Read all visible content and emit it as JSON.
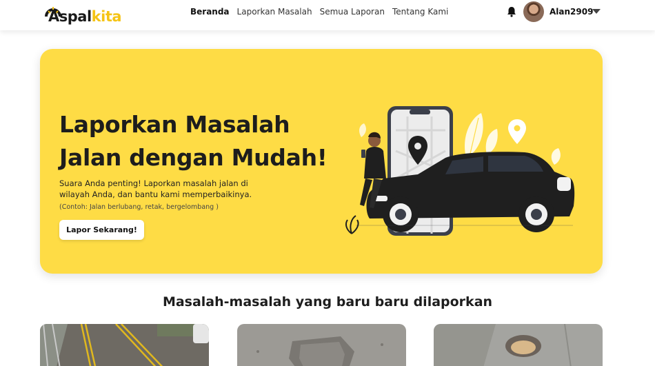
{
  "brand": {
    "part1": "Aspal",
    "part2": "kita",
    "accent": "#f5c416"
  },
  "nav": {
    "items": [
      {
        "label": "Beranda",
        "active": true
      },
      {
        "label": "Laporkan Masalah",
        "active": false
      },
      {
        "label": "Semua Laporan",
        "active": false
      },
      {
        "label": "Tentang Kami",
        "active": false
      }
    ]
  },
  "user": {
    "name": "Alan2909",
    "icons": [
      "bell-icon",
      "chevron-down-icon"
    ]
  },
  "hero": {
    "title_line1": "Laporkan Masalah",
    "title_line2": "Jalan dengan Mudah!",
    "description": "Suara Anda penting! Laporkan masalah jalan di wilayah Anda, dan bantu kami memperbaikinya.",
    "example": "(Contoh: Jalan berlubang, retak, bergelombang )",
    "cta_label": "Lapor Sekarang!",
    "background": "#fedc45"
  },
  "recent": {
    "title": "Masalah-masalah yang baru baru dilaporkan"
  }
}
